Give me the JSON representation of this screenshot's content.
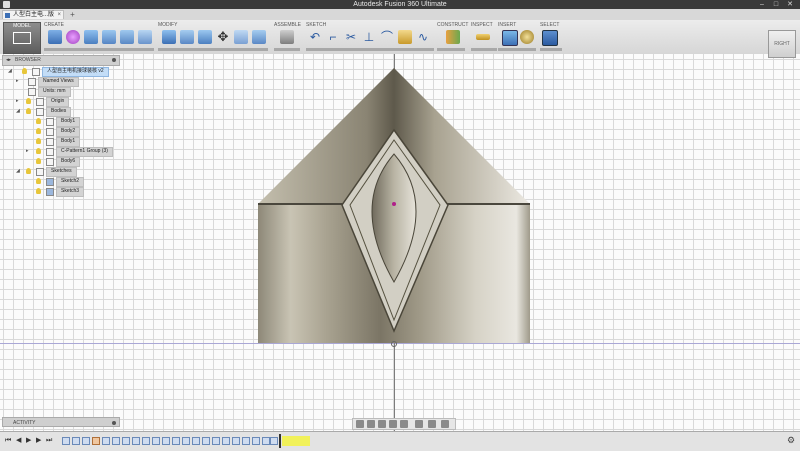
{
  "window": {
    "title": "Autodesk Fusion 360 Ultimate"
  },
  "tab": {
    "label": "人型白主电...版 v2*"
  },
  "workspace": {
    "label": "MODEL"
  },
  "toolbar_groups": {
    "create": "CREATE",
    "modify": "MODIFY",
    "assemble": "ASSEMBLE",
    "sketch": "SKETCH",
    "construct": "CONSTRUCT",
    "inspect": "INSPECT",
    "insert": "INSERT",
    "select": "SELECT"
  },
  "viewcube": {
    "face": "RIGHT"
  },
  "browser": {
    "title": "BROWSER",
    "root": "人型自主电机接球装核 v2",
    "named_views": "Named Views",
    "units": "Units: mm",
    "origin": "Origin",
    "bodies": "Bodies",
    "body1a": "Body1",
    "body2": "Body2",
    "body1b": "Body1",
    "pattern_group": "C-Pattern1 Group (3)",
    "body6": "Body6",
    "sketches": "Sketches",
    "sketch2": "Sketch2",
    "sketch3": "Sketch3"
  },
  "activity": {
    "label": "ACTIVITY"
  },
  "colors": {
    "accent": "#3c6fb5",
    "timeline_highlight": "#f1f15a",
    "body_metal": "#b3ad9c"
  },
  "icons": [
    "search-icon",
    "gear-icon",
    "play-icon",
    "pin-icon",
    "bulb-icon"
  ]
}
